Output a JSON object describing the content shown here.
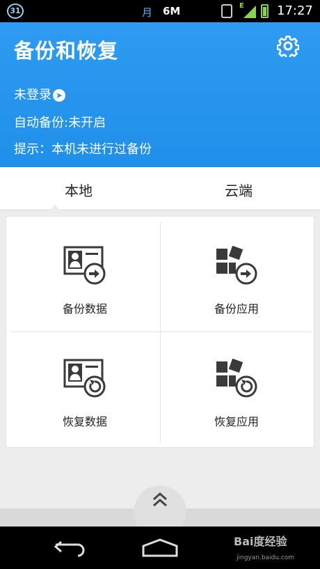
{
  "status_bar": {
    "calendar_day": "31",
    "moon_glyph": "月",
    "data_usage": "6M",
    "time": "17:27"
  },
  "header": {
    "title": "备份和恢复",
    "login": "未登录",
    "auto_backup": "自动备份:未开启",
    "tip": "提示：本机未进行过备份"
  },
  "tabs": [
    {
      "label": "本地",
      "selected": true
    },
    {
      "label": "云端",
      "selected": false
    }
  ],
  "actions": [
    {
      "label": "备份数据",
      "icon": "contact-card-export-icon"
    },
    {
      "label": "备份应用",
      "icon": "apps-export-icon"
    },
    {
      "label": "恢复数据",
      "icon": "contact-card-restore-icon"
    },
    {
      "label": "恢复应用",
      "icon": "apps-restore-icon"
    }
  ],
  "watermark": {
    "brand": "Bai度经验",
    "url": "jingyan.baidu.com"
  },
  "colors": {
    "header": "#2196f3",
    "icon": "#3a3a3a"
  }
}
